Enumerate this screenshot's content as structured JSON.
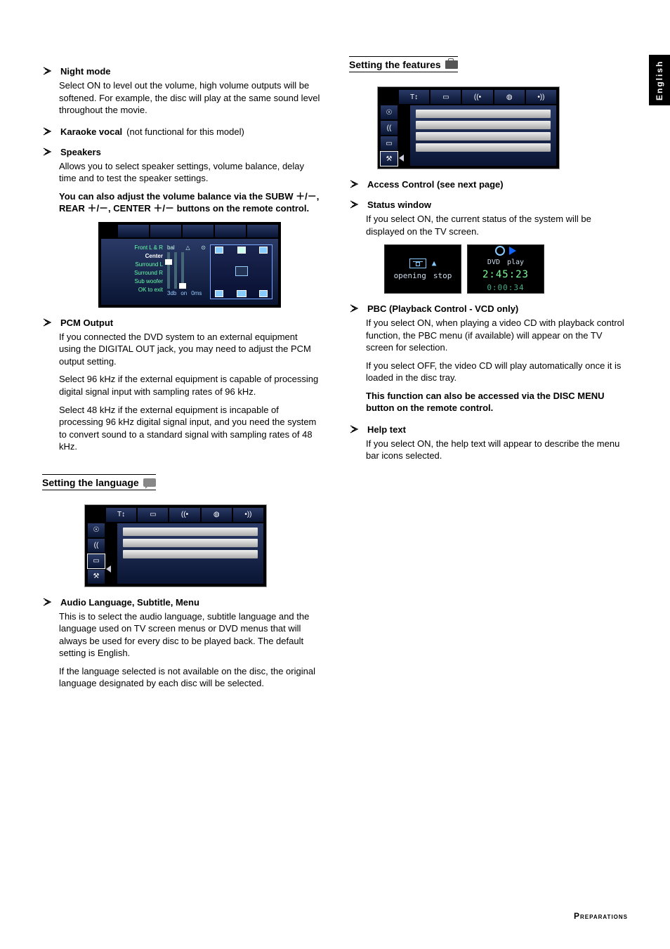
{
  "sideTab": "English",
  "left": {
    "nightMode": {
      "title": "Night mode",
      "body": "Select ON to level out the volume, high volume outputs will be softened. For example, the disc will play at the same sound level throughout the movie."
    },
    "karaoke": {
      "title": "Karaoke vocal",
      "note": "(not functional for this model)"
    },
    "speakers": {
      "title": "Speakers",
      "body": "Allows you to select speaker settings, volume balance, delay time and to test the speaker settings.",
      "bold": "You can also adjust the volume balance via the SUBW ＋/－, REAR ＋/－, CENTER ＋/－ buttons on the remote control."
    },
    "speakerFig": {
      "rows": [
        "Front L & R",
        "Center",
        "Surround L",
        "Surround R",
        "Sub woofer",
        "OK to exit"
      ],
      "volLabels": [
        "bal",
        "△",
        "⊙"
      ],
      "bottom": [
        "3db",
        "on",
        "0ms"
      ]
    },
    "pcm": {
      "title": "PCM Output",
      "p1": "If you connected the DVD system to an external equipment using the DIGITAL OUT jack, you may need to adjust the PCM output setting.",
      "p2": "Select 96 kHz if the external equipment is capable of processing digital signal input with sampling rates of 96 kHz.",
      "p3": "Select 48 kHz if the external equipment is incapable of processing 96 kHz digital signal input, and you need the system to convert sound to a standard signal with sampling rates of 48 kHz."
    },
    "langHeading": "Setting the language",
    "audioLang": {
      "title": "Audio Language, Subtitle, Menu",
      "p1": "This is to select the audio language, subtitle language and the language used on TV screen menus or DVD menus that will always be used for every disc to be played back. The default setting is English.",
      "p2": "If the language selected is not available on the disc, the original language designated by each disc will be selected."
    }
  },
  "right": {
    "featHeading": "Setting the features",
    "access": {
      "title": "Access Control (see next page)"
    },
    "status": {
      "title": "Status window",
      "body": "If you select ON, the current status of the system will be displayed on the TV screen."
    },
    "statusFig": {
      "a": {
        "l1": "opening",
        "l2": "stop"
      },
      "b": {
        "label1": "DVD",
        "label2": "play",
        "time1": "2:45:23",
        "time2": "0:00:34"
      }
    },
    "pbc": {
      "title": "PBC (Playback Control - VCD only)",
      "p1": "If you select ON, when playing a video CD with playback control function, the PBC menu (if available) will appear on the TV screen for selection.",
      "p2": "If you select OFF, the video CD will play automatically once it is loaded in the disc tray.",
      "bold": "This function can also be accessed via the DISC MENU button on the remote control."
    },
    "help": {
      "title": "Help text",
      "body": "If you select ON, the help text will appear to describe the menu bar icons selected."
    }
  },
  "footer": {
    "text": "Preparations"
  }
}
